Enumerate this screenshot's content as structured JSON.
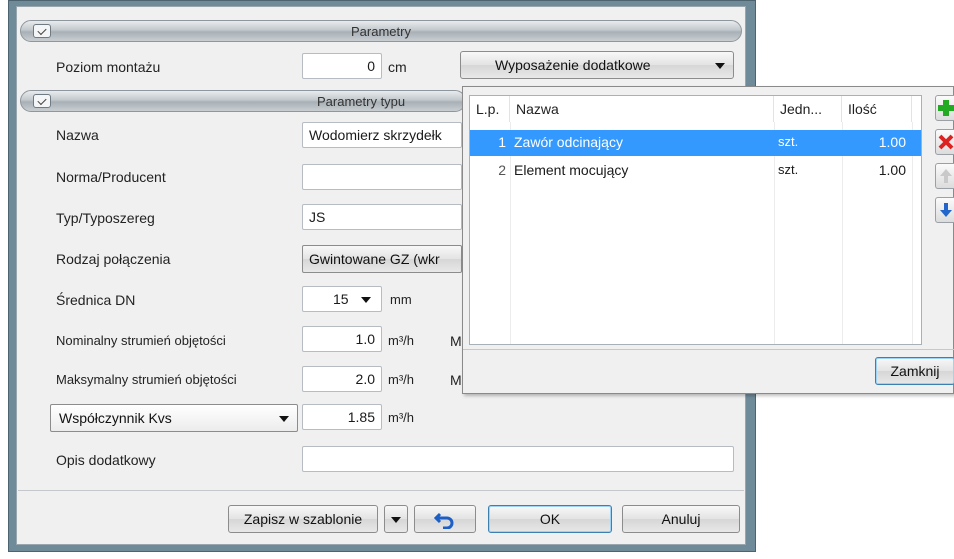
{
  "sections": {
    "params_title": "Parametry",
    "type_params_title": "Parametry typu"
  },
  "mount": {
    "label": "Poziom montażu",
    "value": "0",
    "unit": "cm",
    "extra_button": "Wyposażenie dodatkowe"
  },
  "fields": {
    "name_label": "Nazwa",
    "name_value": "Wodomierz skrzydełk",
    "norm_label": "Norma/Producent",
    "norm_value": "",
    "type_label": "Typ/Typoszereg",
    "type_value": "JS",
    "conn_label": "Rodzaj połączenia",
    "conn_value": "Gwintowane GZ (wkr",
    "dn_label": "Średnica DN",
    "dn_value": "15",
    "dn_unit": "mm",
    "nom_label": "Nominalny strumień objętości",
    "nom_value": "1.0",
    "nom_unit": "m³/h",
    "nom_extra": "M",
    "max_label": "Maksymalny strumień objętości",
    "max_value": "2.0",
    "max_unit": "m³/h",
    "max_extra": "M",
    "kvs_select": "Współczynnik Kvs",
    "kvs_value": "1.85",
    "kvs_unit": "m³/h",
    "desc_label": "Opis dodatkowy",
    "desc_value": ""
  },
  "footer": {
    "save_template": "Zapisz w szablonie",
    "ok": "OK",
    "cancel": "Anuluj"
  },
  "popup": {
    "columns": [
      "L.p.",
      "Nazwa",
      "Jedn...",
      "Ilość"
    ],
    "rows": [
      {
        "lp": "1",
        "name": "Zawór odcinający",
        "unit": "szt.",
        "qty": "1.00",
        "selected": true
      },
      {
        "lp": "2",
        "name": "Element mocujący",
        "unit": "szt.",
        "qty": "1.00",
        "selected": false
      }
    ],
    "close_button": "Zamknij"
  },
  "colors": {
    "selection": "#3399ff",
    "frame": "#6f8a99",
    "add_icon": "#22aa22",
    "delete_icon": "#dd2222",
    "down_icon": "#2266cc"
  },
  "icons": [
    "chevron-up-icon",
    "dropdown-arrow-icon",
    "undo-icon",
    "add-icon",
    "delete-icon",
    "move-up-icon",
    "move-down-icon"
  ]
}
